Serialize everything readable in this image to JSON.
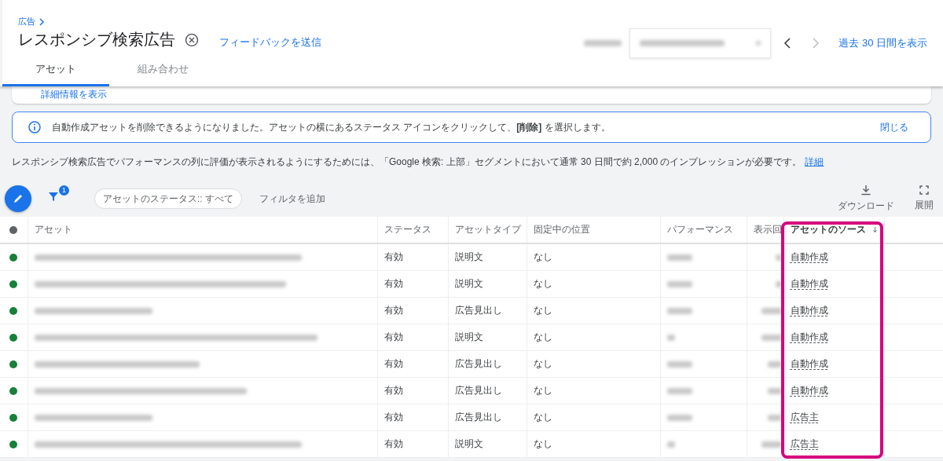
{
  "breadcrumb": "広告",
  "title": "レスポンシブ検索広告",
  "feedback_link": "フィードバックを送信",
  "date_nav": {
    "next_disabled": true
  },
  "show_30_days": "過去 30 日間を表示",
  "tabs": [
    {
      "label": "アセット",
      "selected": true
    },
    {
      "label": "組み合わせ",
      "selected": false
    }
  ],
  "details_link": "詳細情報を表示",
  "banner": {
    "message": "自動作成アセットを削除できるようになりました。アセットの横にあるステータス アイコンをクリックして、**[削除]** を選択します。",
    "close": "閉じる"
  },
  "note": {
    "text": "レスポンシブ検索広告でパフォーマンスの列に評価が表示されるようにするためには、「Google 検索: 上部」セグメントにおいて通常 30 日間で約 2,000 のインプレッションが必要です。",
    "link": "詳細"
  },
  "toolbar": {
    "filter_count": "1",
    "status_chip": "アセットのステータス:: すべて",
    "add_filter": "フィルタを追加",
    "download": "ダウンロード",
    "expand": "展開"
  },
  "table": {
    "columns": [
      {
        "label": "アセット",
        "sorted": false
      },
      {
        "label": "ステータス",
        "sorted": false
      },
      {
        "label": "アセットタイプ",
        "sorted": false
      },
      {
        "label": "固定中の位置",
        "sorted": false
      },
      {
        "label": "パフォーマンス",
        "sorted": false
      },
      {
        "label": "表示回",
        "sorted": false
      },
      {
        "label": "アセットのソース",
        "sorted": true
      }
    ],
    "rows": [
      {
        "color": "#188038",
        "status": "有効",
        "type": "説明文",
        "position": "なし",
        "source": "自動作成"
      },
      {
        "color": "#188038",
        "status": "有効",
        "type": "説明文",
        "position": "なし",
        "source": "自動作成"
      },
      {
        "color": "#188038",
        "status": "有効",
        "type": "広告見出し",
        "position": "なし",
        "source": "自動作成"
      },
      {
        "color": "#188038",
        "status": "有効",
        "type": "説明文",
        "position": "なし",
        "source": "自動作成"
      },
      {
        "color": "#188038",
        "status": "有効",
        "type": "広告見出し",
        "position": "なし",
        "source": "自動作成"
      },
      {
        "color": "#188038",
        "status": "有効",
        "type": "広告見出し",
        "position": "なし",
        "source": "自動作成"
      },
      {
        "color": "#188038",
        "status": "有効",
        "type": "広告見出し",
        "position": "なし",
        "source": "広告主"
      },
      {
        "color": "#188038",
        "status": "有効",
        "type": "説明文",
        "position": "なし",
        "source": "広告主"
      }
    ]
  }
}
